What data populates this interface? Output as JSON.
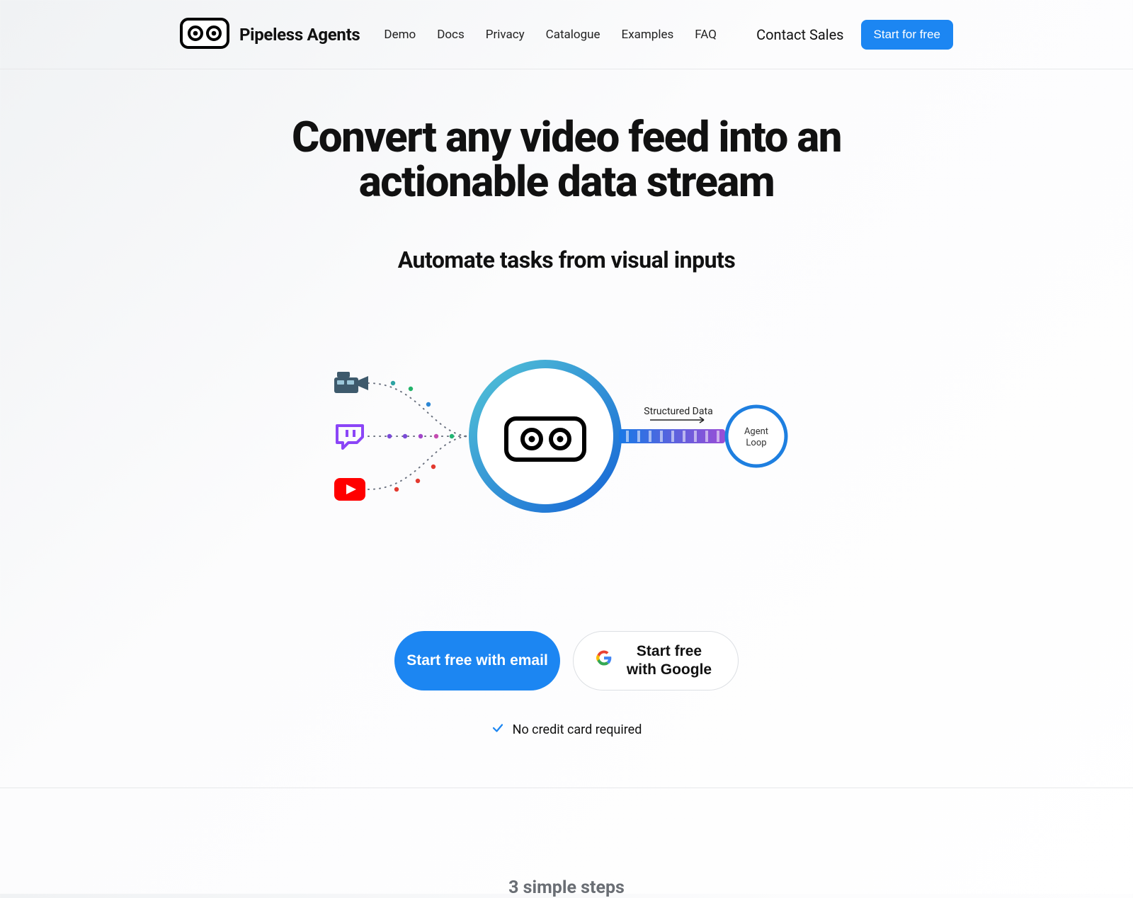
{
  "brand": {
    "name": "Pipeless Agents"
  },
  "nav": {
    "items": [
      {
        "label": "Demo"
      },
      {
        "label": "Docs"
      },
      {
        "label": "Privacy"
      },
      {
        "label": "Catalogue"
      },
      {
        "label": "Examples"
      },
      {
        "label": "FAQ"
      }
    ]
  },
  "header": {
    "contact": "Contact Sales",
    "cta": "Start for free"
  },
  "hero": {
    "title": "Convert any video feed into an actionable data stream",
    "subtitle": "Automate tasks from visual inputs"
  },
  "diagram": {
    "structured_label": "Structured Data",
    "agent_loop_line1": "Agent",
    "agent_loop_line2": "Loop"
  },
  "cta": {
    "email": "Start free with email",
    "google": "Start free with Google",
    "no_credit": "No credit card required"
  },
  "sections": {
    "steps_title": "3 simple steps"
  }
}
